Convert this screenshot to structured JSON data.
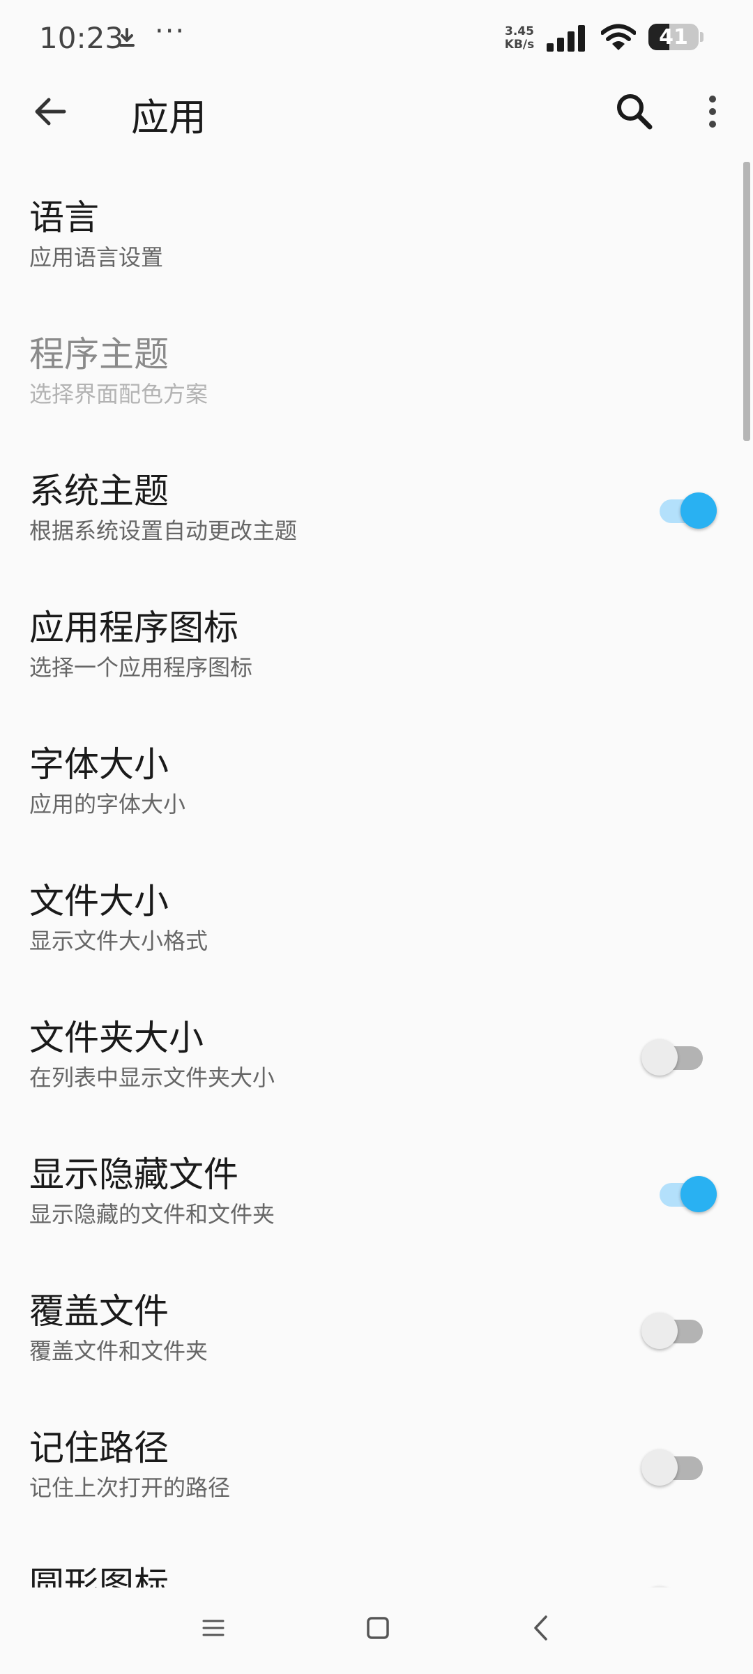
{
  "status_bar": {
    "time": "10:23",
    "more_indicator": "···",
    "net_speed_value": "3.45",
    "net_speed_unit": "KB/s",
    "battery_level": "41",
    "battery_fraction": 0.41
  },
  "app_bar": {
    "title": "应用",
    "back_icon": "arrow-back-icon",
    "search_icon": "search-icon",
    "overflow_icon": "more-vert-icon"
  },
  "settings": [
    {
      "title": "语言",
      "subtitle": "应用语言设置",
      "toggle": null,
      "enabled": true
    },
    {
      "title": "程序主题",
      "subtitle": "选择界面配色方案",
      "toggle": null,
      "enabled": false
    },
    {
      "title": "系统主题",
      "subtitle": "根据系统设置自动更改主题",
      "toggle": true,
      "enabled": true
    },
    {
      "title": "应用程序图标",
      "subtitle": "选择一个应用程序图标",
      "toggle": null,
      "enabled": true
    },
    {
      "title": "字体大小",
      "subtitle": "应用的字体大小",
      "toggle": null,
      "enabled": true
    },
    {
      "title": "文件大小",
      "subtitle": "显示文件大小格式",
      "toggle": null,
      "enabled": true
    },
    {
      "title": "文件夹大小",
      "subtitle": "在列表中显示文件夹大小",
      "toggle": false,
      "enabled": true
    },
    {
      "title": "显示隐藏文件",
      "subtitle": "显示隐藏的文件和文件夹",
      "toggle": true,
      "enabled": true
    },
    {
      "title": "覆盖文件",
      "subtitle": "覆盖文件和文件夹",
      "toggle": false,
      "enabled": true
    },
    {
      "title": "记住路径",
      "subtitle": "记住上次打开的路径",
      "toggle": false,
      "enabled": true
    },
    {
      "title": "圆形图标",
      "subtitle": "",
      "toggle": false,
      "enabled": true
    }
  ],
  "colors": {
    "accent": "#29b1f2",
    "accent_track": "#b3e0fb",
    "background": "#fafafa"
  },
  "nav_bar": {
    "menu_icon": "menu-icon",
    "home_icon": "home-icon",
    "back_icon": "back-icon"
  }
}
